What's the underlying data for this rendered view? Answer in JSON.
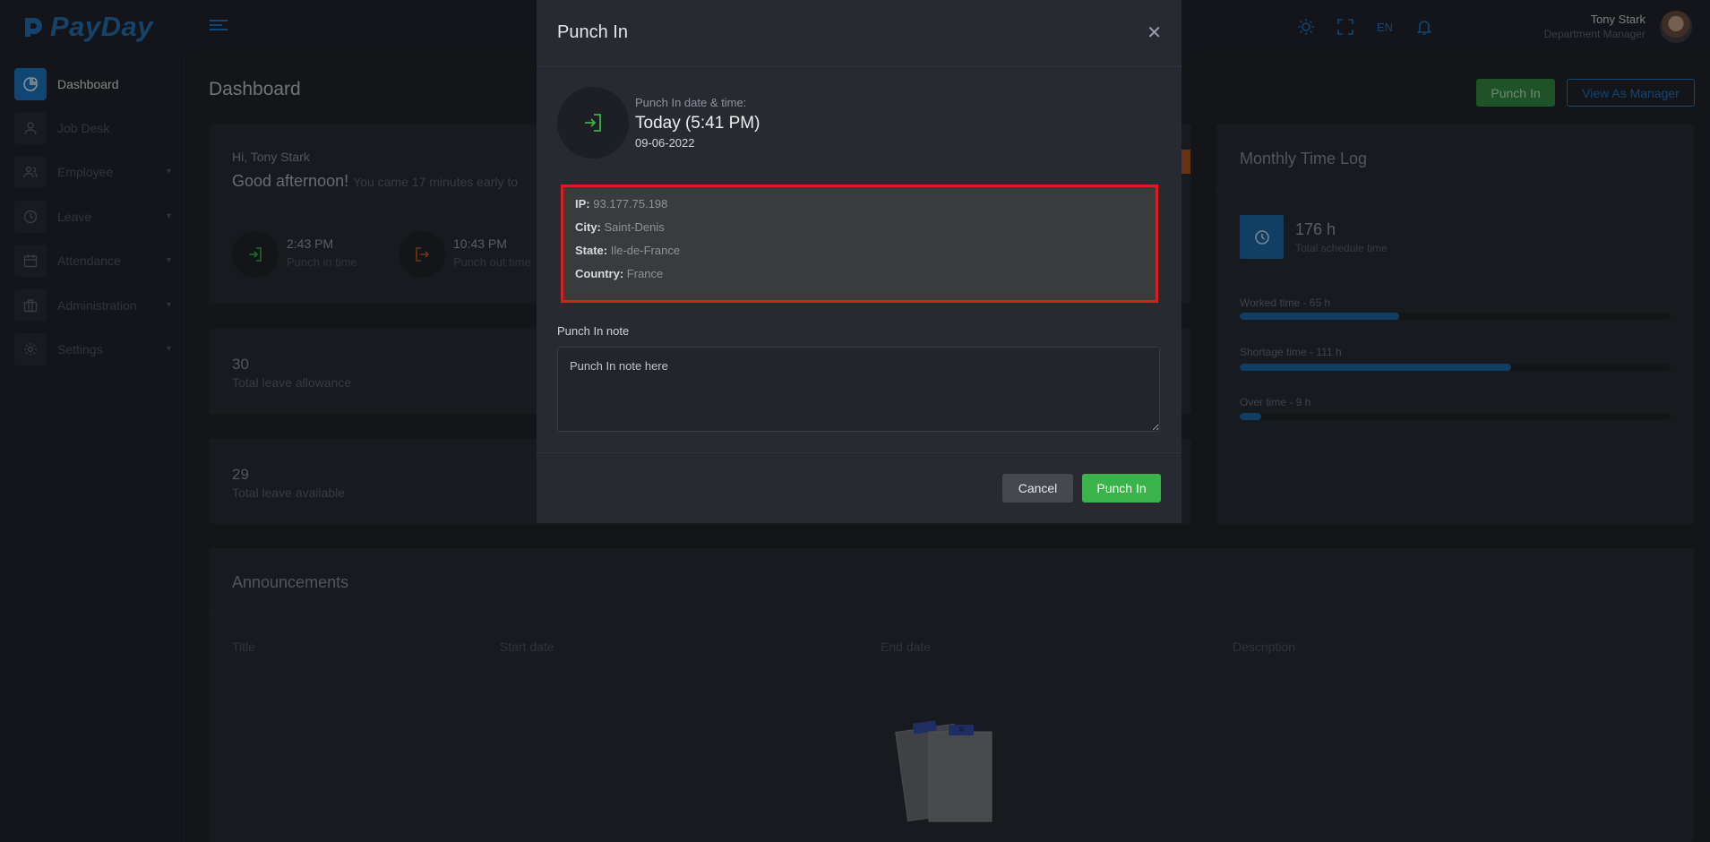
{
  "app": {
    "logo_text": "PayDay"
  },
  "header": {
    "language": "EN",
    "user_name": "Tony Stark",
    "user_role": "Department Manager"
  },
  "sidebar": {
    "items": [
      {
        "label": "Dashboard",
        "icon": "pie-chart-icon",
        "active": true
      },
      {
        "label": "Job Desk",
        "icon": "user-icon"
      },
      {
        "label": "Employee",
        "icon": "users-icon"
      },
      {
        "label": "Leave",
        "icon": "clock-icon"
      },
      {
        "label": "Attendance",
        "icon": "calendar-icon"
      },
      {
        "label": "Administration",
        "icon": "briefcase-icon"
      },
      {
        "label": "Settings",
        "icon": "gear-icon"
      }
    ]
  },
  "page": {
    "title": "Dashboard",
    "punch_in_button": "Punch In",
    "view_manager_button": "View As Manager"
  },
  "welcome": {
    "hello": "Hi, Tony Stark",
    "greeting": "Good afternoon!",
    "greeting_sub": "You came 17 minutes early to",
    "punch_in_time": "2:43 PM",
    "punch_in_label": "Punch in time",
    "punch_out_time": "10:43 PM",
    "punch_out_label": "Punch out time"
  },
  "leave_allowance": {
    "value": "30",
    "label": "Total leave allowance"
  },
  "leave_available": {
    "value": "29",
    "label": "Total leave available"
  },
  "time_log": {
    "title": "Monthly Time Log",
    "schedule_value": "176 h",
    "schedule_label": "Total schedule time",
    "bars": [
      {
        "label": "Worked time - 65 h",
        "percent": 37
      },
      {
        "label": "Shortage time - 111 h",
        "percent": 63
      },
      {
        "label": "Over time - 9 h",
        "percent": 5
      }
    ]
  },
  "announcements": {
    "title": "Announcements",
    "columns": [
      "Title",
      "Start date",
      "End date",
      "Description"
    ]
  },
  "modal": {
    "title": "Punch In",
    "caption": "Punch In date & time:",
    "today": "Today (5:41 PM)",
    "date": "09-06-2022",
    "ip_label": "IP:",
    "ip": "93.177.75.198",
    "city_label": "City:",
    "city": "Saint-Denis",
    "state_label": "State:",
    "state": "Ile-de-France",
    "country_label": "Country:",
    "country": "France",
    "note_label": "Punch In note",
    "note_placeholder": "Punch In note here",
    "cancel": "Cancel",
    "submit": "Punch In"
  },
  "colors": {
    "brand": "#1f6fb5",
    "accent_blue": "#1774c4",
    "success": "#3ab34a",
    "danger_outline": "#d81e1e",
    "punch_out_orange": "#c8541a"
  }
}
